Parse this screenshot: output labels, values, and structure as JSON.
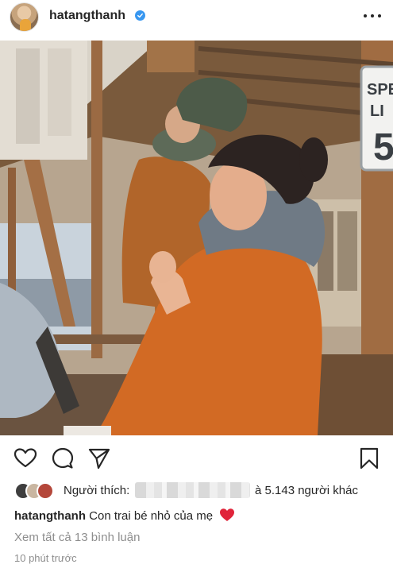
{
  "post": {
    "username": "hatangthanh",
    "verified": true,
    "likes_label": "Người thích:",
    "likes_others": "à 5.143 người khác",
    "caption_user": "hatangthanh",
    "caption_text": "Con trai bé nhỏ của mẹ",
    "caption_emoji": "red-heart",
    "view_comments": "Xem tất cả 13 bình luận",
    "time_ago": "10 phút trước",
    "sign_text": [
      "SPE",
      "LI",
      "5"
    ]
  },
  "icons": {
    "like": "heart-icon",
    "comment": "comment-icon",
    "share": "paper-plane-icon",
    "save": "bookmark-icon",
    "more": "more-options-icon"
  },
  "colors": {
    "verified_blue": "#3897f0",
    "text": "#262626",
    "muted": "#8e8e8e",
    "heart_red": "#ed4956"
  }
}
